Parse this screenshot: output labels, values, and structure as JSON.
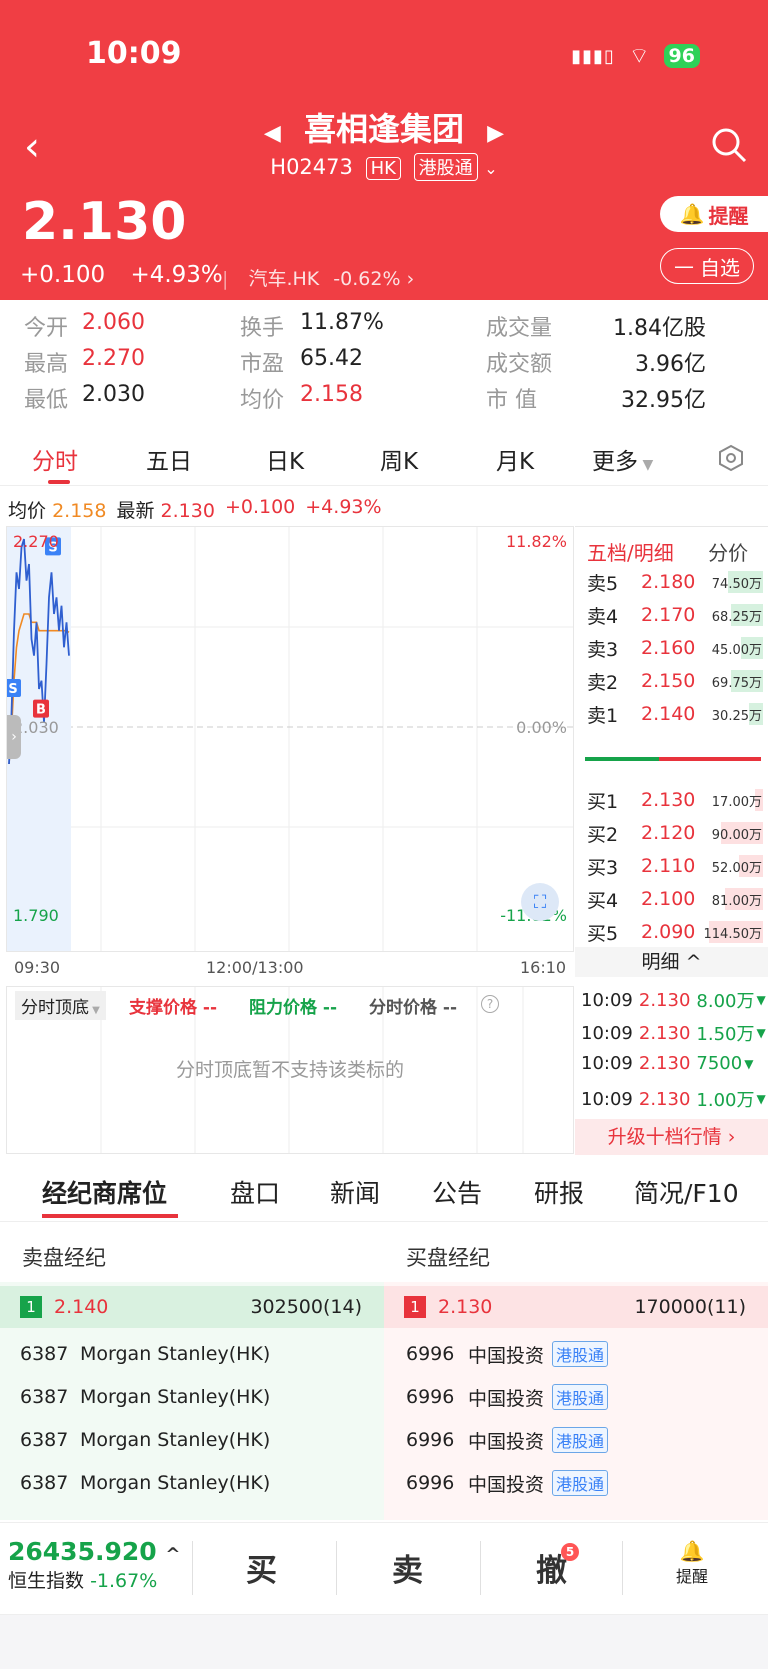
{
  "status": {
    "time": "10:09",
    "battery": "96"
  },
  "stock": {
    "name": "喜相逢集团",
    "code": "H02473",
    "market": "HK",
    "connect": "港股通",
    "price": "2.130",
    "change": "+0.100",
    "change_pct": "+4.93%",
    "sector": "汽车.HK",
    "sector_pct": "-0.62%",
    "alert_label": "提醒",
    "fav_label": "自选"
  },
  "stats": [
    {
      "label": "今开",
      "value": "2.060",
      "color": "red"
    },
    {
      "label": "换手",
      "value": "11.87%",
      "color": "black"
    },
    {
      "label": "成交量",
      "value": "1.84亿股",
      "color": "black"
    },
    {
      "label": "最高",
      "value": "2.270",
      "color": "red"
    },
    {
      "label": "市盈",
      "value": "65.42",
      "color": "black"
    },
    {
      "label": "成交额",
      "value": "3.96亿",
      "color": "black"
    },
    {
      "label": "最低",
      "value": "2.030",
      "color": "black"
    },
    {
      "label": "均价",
      "value": "2.158",
      "color": "red"
    },
    {
      "label": "市 值",
      "value": "32.95亿",
      "color": "black"
    }
  ],
  "tabs": [
    "分时",
    "五日",
    "日K",
    "周K",
    "月K",
    "更多"
  ],
  "avgline": {
    "avg_label": "均价",
    "avg": "2.158",
    "latest_label": "最新",
    "latest": "2.130",
    "chg": "+0.100",
    "pct": "+4.93%"
  },
  "chart_data": {
    "type": "line",
    "y_top": "2.270",
    "y_mid": "2.030",
    "y_bottom": "1.790",
    "pct_top": "11.82%",
    "pct_mid": "0.00%",
    "pct_bottom": "-11.82%",
    "x_ticks": [
      "09:30",
      "12:00/13:00",
      "16:10"
    ],
    "ylim": [
      1.79,
      2.27
    ],
    "price": [
      2.0,
      2.06,
      2.16,
      2.23,
      2.21,
      2.26,
      2.27,
      2.22,
      2.24,
      2.15,
      2.13,
      2.17,
      2.09,
      2.1,
      2.05,
      2.12,
      2.2,
      2.23,
      2.18,
      2.2,
      2.16,
      2.19,
      2.14,
      2.17,
      2.13
    ],
    "avg": [
      2.0,
      2.04,
      2.1,
      2.14,
      2.16,
      2.17,
      2.18,
      2.18,
      2.18,
      2.17,
      2.17,
      2.17,
      2.16,
      2.16,
      2.16,
      2.16,
      2.16,
      2.16,
      2.16,
      2.16,
      2.16,
      2.16,
      2.16,
      2.16,
      2.158
    ],
    "markers": [
      {
        "label": "S"
      },
      {
        "label": "S"
      },
      {
        "label": "S"
      },
      {
        "label": "S"
      },
      {
        "label": "B"
      }
    ]
  },
  "indicators": {
    "bottom_top": "分时顶底",
    "support": "支撑价格 --",
    "resist": "阻力价格 --",
    "intraday": "分时价格 --",
    "notice": "分时顶底暂不支持该类标的"
  },
  "orderbook": {
    "title": "五档/明细",
    "alt": "分价",
    "asks": [
      {
        "label": "卖5",
        "price": "2.180",
        "vol": "74.50万",
        "fill": 0.65
      },
      {
        "label": "卖4",
        "price": "2.170",
        "vol": "68.25万",
        "fill": 0.6
      },
      {
        "label": "卖3",
        "price": "2.160",
        "vol": "45.00万",
        "fill": 0.4
      },
      {
        "label": "卖2",
        "price": "2.150",
        "vol": "69.75万",
        "fill": 0.6
      },
      {
        "label": "卖1",
        "price": "2.140",
        "vol": "30.25万",
        "fill": 0.26
      }
    ],
    "bids": [
      {
        "label": "买1",
        "price": "2.130",
        "vol": "17.00万",
        "fill": 0.15
      },
      {
        "label": "买2",
        "price": "2.120",
        "vol": "90.00万",
        "fill": 0.78
      },
      {
        "label": "买3",
        "price": "2.110",
        "vol": "52.00万",
        "fill": 0.45
      },
      {
        "label": "买4",
        "price": "2.100",
        "vol": "81.00万",
        "fill": 0.7
      },
      {
        "label": "买5",
        "price": "2.090",
        "vol": "114.50万",
        "fill": 1.0
      }
    ],
    "detail_label": "明细",
    "trades": [
      {
        "time": "10:09",
        "price": "2.130",
        "vol": "8.00万"
      },
      {
        "time": "10:09",
        "price": "2.130",
        "vol": "1.50万"
      },
      {
        "time": "10:09",
        "price": "2.130",
        "vol": "7500"
      },
      {
        "time": "10:09",
        "price": "2.130",
        "vol": "1.00万"
      }
    ],
    "upgrade": "升级十档行情"
  },
  "content_tabs": [
    "经纪商席位",
    "盘口",
    "新闻",
    "公告",
    "研报",
    "简况/F10"
  ],
  "brokers": {
    "sell_title": "卖盘经纪",
    "buy_title": "买盘经纪",
    "sell_top": {
      "level": "1",
      "price": "2.140",
      "qty": "302500(14)"
    },
    "buy_top": {
      "level": "1",
      "price": "2.130",
      "qty": "170000(11)"
    },
    "sell_rows": [
      {
        "id": "6387",
        "name": "Morgan Stanley(HK)"
      },
      {
        "id": "6387",
        "name": "Morgan Stanley(HK)"
      },
      {
        "id": "6387",
        "name": "Morgan Stanley(HK)"
      },
      {
        "id": "6387",
        "name": "Morgan Stanley(HK)"
      }
    ],
    "buy_rows": [
      {
        "id": "6996",
        "name": "中国投资",
        "tag": "港股通"
      },
      {
        "id": "6996",
        "name": "中国投资",
        "tag": "港股通"
      },
      {
        "id": "6996",
        "name": "中国投资",
        "tag": "港股通"
      },
      {
        "id": "6996",
        "name": "中国投资",
        "tag": "港股通"
      }
    ]
  },
  "bottom": {
    "index_value": "26435.920",
    "index_name": "恒生指数",
    "index_pct": "-1.67%",
    "buy": "买",
    "sell": "卖",
    "cancel": "撤",
    "cancel_badge": "5",
    "alert": "提醒"
  }
}
